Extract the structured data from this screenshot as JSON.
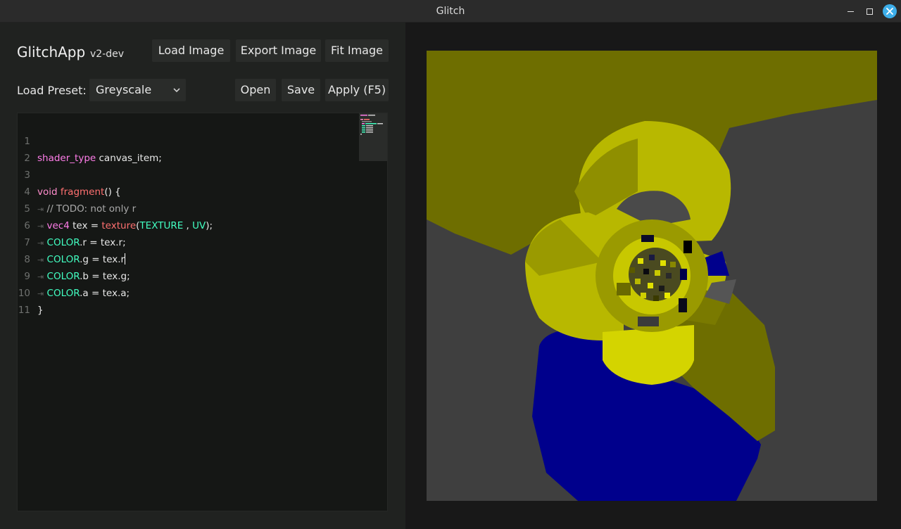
{
  "window": {
    "title": "Glitch"
  },
  "app": {
    "name": "GlitchApp",
    "version": "v2-dev"
  },
  "toolbar": {
    "load_image": "Load Image",
    "export_image": "Export Image",
    "fit_image": "Fit Image"
  },
  "preset": {
    "label": "Load Preset:",
    "selected": "Greyscale",
    "open": "Open",
    "save": "Save",
    "apply": "Apply (F5)"
  },
  "editor": {
    "lines": [
      {
        "num": "1",
        "t1": "shader_type",
        "t2": " canvas_item;"
      },
      {
        "num": "2"
      },
      {
        "num": "3",
        "t1": "void",
        "t2": " ",
        "t3": "fragment",
        "t4": "() {"
      },
      {
        "num": "4",
        "indent": "⇥",
        "t1": "// TODO: not only r"
      },
      {
        "num": "5",
        "indent": "⇥",
        "t1": "vec4",
        "t2": " tex = ",
        "t3": "texture",
        "t4": "(",
        "t5": "TEXTURE",
        "t6": " , ",
        "t7": "UV",
        "t8": ");"
      },
      {
        "num": "6",
        "indent": "⇥",
        "t1": "COLOR",
        "t2": ".r = tex.r;"
      },
      {
        "num": "7",
        "indent": "⇥",
        "t1": "COLOR",
        "t2": ".g = tex.r"
      },
      {
        "num": "8",
        "indent": "⇥",
        "t1": "COLOR",
        "t2": ".b = tex.g;"
      },
      {
        "num": "9",
        "indent": "⇥",
        "t1": "COLOR",
        "t2": ".a = tex.a;"
      },
      {
        "num": "10",
        "t1": "}"
      },
      {
        "num": "11"
      }
    ]
  },
  "colors": {
    "accent": "#3daee9",
    "canvas_yellow": "#b8b800",
    "canvas_olive": "#6e6e00",
    "canvas_blue": "#00008c",
    "canvas_grey": "#3f3f3f"
  }
}
